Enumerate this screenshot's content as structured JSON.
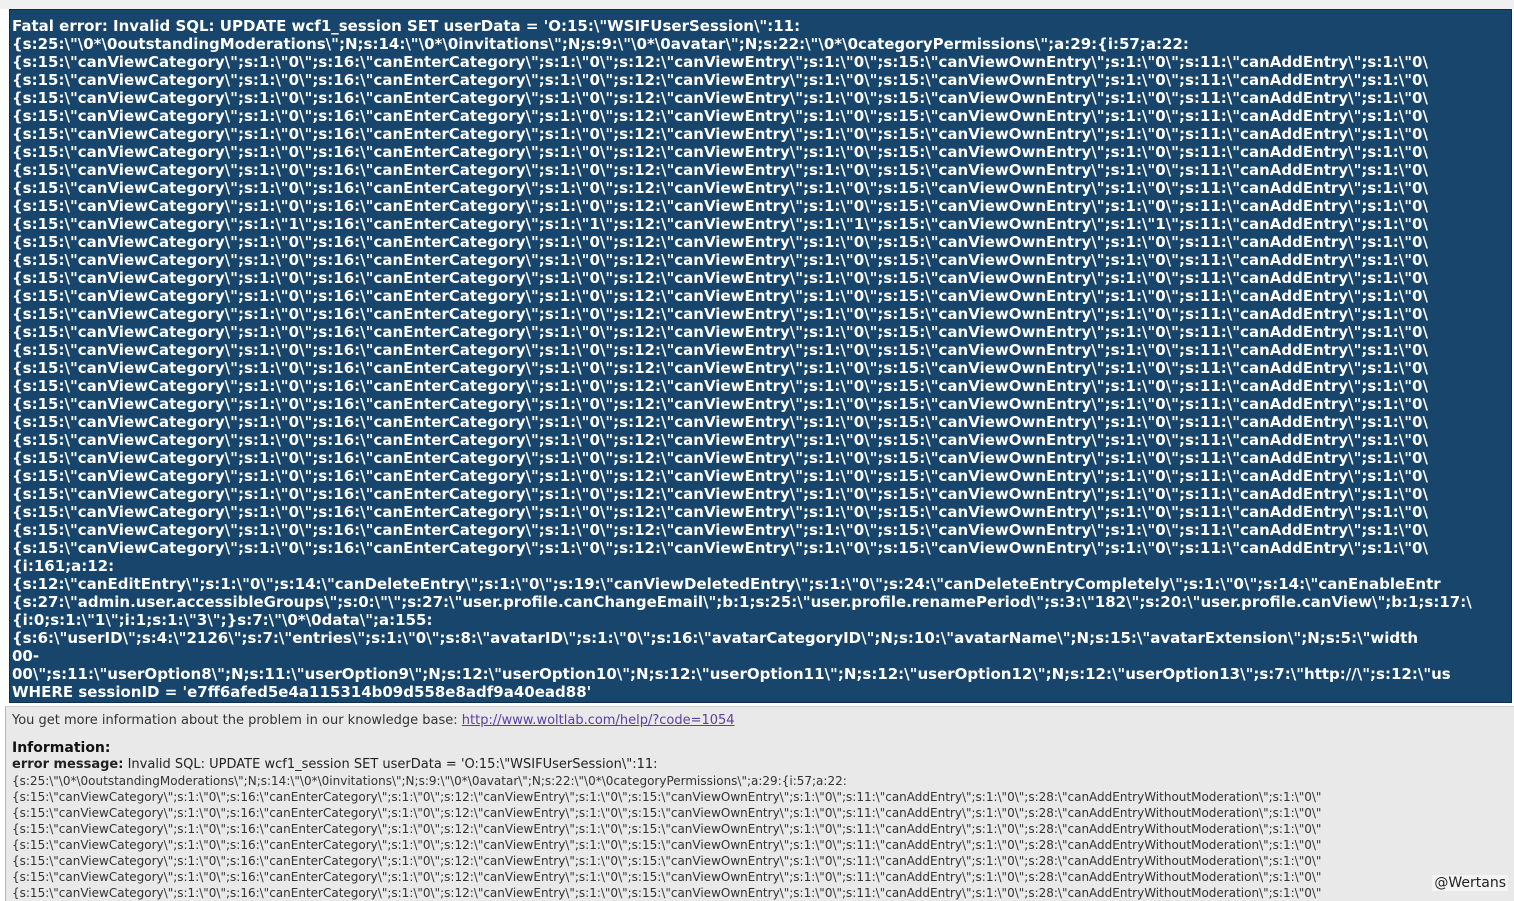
{
  "error": {
    "lines": [
      "Fatal error: Invalid SQL: UPDATE wcf1_session SET userData = 'O:15:\\\"WSIFUserSession\\\":11:",
      "{s:25:\\\"\\0*\\0outstandingModerations\\\";N;s:14:\\\"\\0*\\0invitations\\\";N;s:9:\\\"\\0*\\0avatar\\\";N;s:22:\\\"\\0*\\0categoryPermissions\\\";a:29:{i:57;a:22:",
      "{s:15:\\\"canViewCategory\\\";s:1:\\\"0\\\";s:16:\\\"canEnterCategory\\\";s:1:\\\"0\\\";s:12:\\\"canViewEntry\\\";s:1:\\\"0\\\";s:15:\\\"canViewOwnEntry\\\";s:1:\\\"0\\\";s:11:\\\"canAddEntry\\\";s:1:\\\"0\\",
      "{s:15:\\\"canViewCategory\\\";s:1:\\\"0\\\";s:16:\\\"canEnterCategory\\\";s:1:\\\"0\\\";s:12:\\\"canViewEntry\\\";s:1:\\\"0\\\";s:15:\\\"canViewOwnEntry\\\";s:1:\\\"0\\\";s:11:\\\"canAddEntry\\\";s:1:\\\"0\\",
      "{s:15:\\\"canViewCategory\\\";s:1:\\\"0\\\";s:16:\\\"canEnterCategory\\\";s:1:\\\"0\\\";s:12:\\\"canViewEntry\\\";s:1:\\\"0\\\";s:15:\\\"canViewOwnEntry\\\";s:1:\\\"0\\\";s:11:\\\"canAddEntry\\\";s:1:\\\"0\\",
      "{s:15:\\\"canViewCategory\\\";s:1:\\\"0\\\";s:16:\\\"canEnterCategory\\\";s:1:\\\"0\\\";s:12:\\\"canViewEntry\\\";s:1:\\\"0\\\";s:15:\\\"canViewOwnEntry\\\";s:1:\\\"0\\\";s:11:\\\"canAddEntry\\\";s:1:\\\"0\\",
      "{s:15:\\\"canViewCategory\\\";s:1:\\\"0\\\";s:16:\\\"canEnterCategory\\\";s:1:\\\"0\\\";s:12:\\\"canViewEntry\\\";s:1:\\\"0\\\";s:15:\\\"canViewOwnEntry\\\";s:1:\\\"0\\\";s:11:\\\"canAddEntry\\\";s:1:\\\"0\\",
      "{s:15:\\\"canViewCategory\\\";s:1:\\\"0\\\";s:16:\\\"canEnterCategory\\\";s:1:\\\"0\\\";s:12:\\\"canViewEntry\\\";s:1:\\\"0\\\";s:15:\\\"canViewOwnEntry\\\";s:1:\\\"0\\\";s:11:\\\"canAddEntry\\\";s:1:\\\"0\\",
      "{s:15:\\\"canViewCategory\\\";s:1:\\\"0\\\";s:16:\\\"canEnterCategory\\\";s:1:\\\"0\\\";s:12:\\\"canViewEntry\\\";s:1:\\\"0\\\";s:15:\\\"canViewOwnEntry\\\";s:1:\\\"0\\\";s:11:\\\"canAddEntry\\\";s:1:\\\"0\\",
      "{s:15:\\\"canViewCategory\\\";s:1:\\\"0\\\";s:16:\\\"canEnterCategory\\\";s:1:\\\"0\\\";s:12:\\\"canViewEntry\\\";s:1:\\\"0\\\";s:15:\\\"canViewOwnEntry\\\";s:1:\\\"0\\\";s:11:\\\"canAddEntry\\\";s:1:\\\"0\\",
      "{s:15:\\\"canViewCategory\\\";s:1:\\\"0\\\";s:16:\\\"canEnterCategory\\\";s:1:\\\"0\\\";s:12:\\\"canViewEntry\\\";s:1:\\\"0\\\";s:15:\\\"canViewOwnEntry\\\";s:1:\\\"0\\\";s:11:\\\"canAddEntry\\\";s:1:\\\"0\\",
      "{s:15:\\\"canViewCategory\\\";s:1:\\\"1\\\";s:16:\\\"canEnterCategory\\\";s:1:\\\"1\\\";s:12:\\\"canViewEntry\\\";s:1:\\\"1\\\";s:15:\\\"canViewOwnEntry\\\";s:1:\\\"1\\\";s:11:\\\"canAddEntry\\\";s:1:\\\"0\\",
      "{s:15:\\\"canViewCategory\\\";s:1:\\\"0\\\";s:16:\\\"canEnterCategory\\\";s:1:\\\"0\\\";s:12:\\\"canViewEntry\\\";s:1:\\\"0\\\";s:15:\\\"canViewOwnEntry\\\";s:1:\\\"0\\\";s:11:\\\"canAddEntry\\\";s:1:\\\"0\\",
      "{s:15:\\\"canViewCategory\\\";s:1:\\\"0\\\";s:16:\\\"canEnterCategory\\\";s:1:\\\"0\\\";s:12:\\\"canViewEntry\\\";s:1:\\\"0\\\";s:15:\\\"canViewOwnEntry\\\";s:1:\\\"0\\\";s:11:\\\"canAddEntry\\\";s:1:\\\"0\\",
      "{s:15:\\\"canViewCategory\\\";s:1:\\\"0\\\";s:16:\\\"canEnterCategory\\\";s:1:\\\"0\\\";s:12:\\\"canViewEntry\\\";s:1:\\\"0\\\";s:15:\\\"canViewOwnEntry\\\";s:1:\\\"0\\\";s:11:\\\"canAddEntry\\\";s:1:\\\"0\\",
      "{s:15:\\\"canViewCategory\\\";s:1:\\\"0\\\";s:16:\\\"canEnterCategory\\\";s:1:\\\"0\\\";s:12:\\\"canViewEntry\\\";s:1:\\\"0\\\";s:15:\\\"canViewOwnEntry\\\";s:1:\\\"0\\\";s:11:\\\"canAddEntry\\\";s:1:\\\"0\\",
      "{s:15:\\\"canViewCategory\\\";s:1:\\\"0\\\";s:16:\\\"canEnterCategory\\\";s:1:\\\"0\\\";s:12:\\\"canViewEntry\\\";s:1:\\\"0\\\";s:15:\\\"canViewOwnEntry\\\";s:1:\\\"0\\\";s:11:\\\"canAddEntry\\\";s:1:\\\"0\\",
      "{s:15:\\\"canViewCategory\\\";s:1:\\\"0\\\";s:16:\\\"canEnterCategory\\\";s:1:\\\"0\\\";s:12:\\\"canViewEntry\\\";s:1:\\\"0\\\";s:15:\\\"canViewOwnEntry\\\";s:1:\\\"0\\\";s:11:\\\"canAddEntry\\\";s:1:\\\"0\\",
      "{s:15:\\\"canViewCategory\\\";s:1:\\\"0\\\";s:16:\\\"canEnterCategory\\\";s:1:\\\"0\\\";s:12:\\\"canViewEntry\\\";s:1:\\\"0\\\";s:15:\\\"canViewOwnEntry\\\";s:1:\\\"0\\\";s:11:\\\"canAddEntry\\\";s:1:\\\"0\\",
      "{s:15:\\\"canViewCategory\\\";s:1:\\\"0\\\";s:16:\\\"canEnterCategory\\\";s:1:\\\"0\\\";s:12:\\\"canViewEntry\\\";s:1:\\\"0\\\";s:15:\\\"canViewOwnEntry\\\";s:1:\\\"0\\\";s:11:\\\"canAddEntry\\\";s:1:\\\"0\\",
      "{s:15:\\\"canViewCategory\\\";s:1:\\\"0\\\";s:16:\\\"canEnterCategory\\\";s:1:\\\"0\\\";s:12:\\\"canViewEntry\\\";s:1:\\\"0\\\";s:15:\\\"canViewOwnEntry\\\";s:1:\\\"0\\\";s:11:\\\"canAddEntry\\\";s:1:\\\"0\\",
      "{s:15:\\\"canViewCategory\\\";s:1:\\\"0\\\";s:16:\\\"canEnterCategory\\\";s:1:\\\"0\\\";s:12:\\\"canViewEntry\\\";s:1:\\\"0\\\";s:15:\\\"canViewOwnEntry\\\";s:1:\\\"0\\\";s:11:\\\"canAddEntry\\\";s:1:\\\"0\\",
      "{s:15:\\\"canViewCategory\\\";s:1:\\\"0\\\";s:16:\\\"canEnterCategory\\\";s:1:\\\"0\\\";s:12:\\\"canViewEntry\\\";s:1:\\\"0\\\";s:15:\\\"canViewOwnEntry\\\";s:1:\\\"0\\\";s:11:\\\"canAddEntry\\\";s:1:\\\"0\\",
      "{s:15:\\\"canViewCategory\\\";s:1:\\\"0\\\";s:16:\\\"canEnterCategory\\\";s:1:\\\"0\\\";s:12:\\\"canViewEntry\\\";s:1:\\\"0\\\";s:15:\\\"canViewOwnEntry\\\";s:1:\\\"0\\\";s:11:\\\"canAddEntry\\\";s:1:\\\"0\\",
      "{s:15:\\\"canViewCategory\\\";s:1:\\\"0\\\";s:16:\\\"canEnterCategory\\\";s:1:\\\"0\\\";s:12:\\\"canViewEntry\\\";s:1:\\\"0\\\";s:15:\\\"canViewOwnEntry\\\";s:1:\\\"0\\\";s:11:\\\"canAddEntry\\\";s:1:\\\"0\\",
      "{s:15:\\\"canViewCategory\\\";s:1:\\\"0\\\";s:16:\\\"canEnterCategory\\\";s:1:\\\"0\\\";s:12:\\\"canViewEntry\\\";s:1:\\\"0\\\";s:15:\\\"canViewOwnEntry\\\";s:1:\\\"0\\\";s:11:\\\"canAddEntry\\\";s:1:\\\"0\\",
      "{s:15:\\\"canViewCategory\\\";s:1:\\\"0\\\";s:16:\\\"canEnterCategory\\\";s:1:\\\"0\\\";s:12:\\\"canViewEntry\\\";s:1:\\\"0\\\";s:15:\\\"canViewOwnEntry\\\";s:1:\\\"0\\\";s:11:\\\"canAddEntry\\\";s:1:\\\"0\\",
      "{s:15:\\\"canViewCategory\\\";s:1:\\\"0\\\";s:16:\\\"canEnterCategory\\\";s:1:\\\"0\\\";s:12:\\\"canViewEntry\\\";s:1:\\\"0\\\";s:15:\\\"canViewOwnEntry\\\";s:1:\\\"0\\\";s:11:\\\"canAddEntry\\\";s:1:\\\"0\\",
      "{s:15:\\\"canViewCategory\\\";s:1:\\\"0\\\";s:16:\\\"canEnterCategory\\\";s:1:\\\"0\\\";s:12:\\\"canViewEntry\\\";s:1:\\\"0\\\";s:15:\\\"canViewOwnEntry\\\";s:1:\\\"0\\\";s:11:\\\"canAddEntry\\\";s:1:\\\"0\\",
      "{s:15:\\\"canViewCategory\\\";s:1:\\\"0\\\";s:16:\\\"canEnterCategory\\\";s:1:\\\"0\\\";s:12:\\\"canViewEntry\\\";s:1:\\\"0\\\";s:15:\\\"canViewOwnEntry\\\";s:1:\\\"0\\\";s:11:\\\"canAddEntry\\\";s:1:\\\"0\\",
      "{i:161;a:12:",
      "{s:12:\\\"canEditEntry\\\";s:1:\\\"0\\\";s:14:\\\"canDeleteEntry\\\";s:1:\\\"0\\\";s:19:\\\"canViewDeletedEntry\\\";s:1:\\\"0\\\";s:24:\\\"canDeleteEntryCompletely\\\";s:1:\\\"0\\\";s:14:\\\"canEnableEntr",
      "{s:27:\\\"admin.user.accessibleGroups\\\";s:0:\\\"\\\";s:27:\\\"user.profile.canChangeEmail\\\";b:1;s:25:\\\"user.profile.renamePeriod\\\";s:3:\\\"182\\\";s:20:\\\"user.profile.canView\\\";b:1;s:17:\\",
      "{i:0;s:1:\\\"1\\\";i:1;s:1:\\\"3\\\";}s:7:\\\"\\0*\\0data\\\";a:155:",
      "{s:6:\\\"userID\\\";s:4:\\\"2126\\\";s:7:\\\"entries\\\";s:1:\\\"0\\\";s:8:\\\"avatarID\\\";s:1:\\\"0\\\";s:16:\\\"avatarCategoryID\\\";N;s:10:\\\"avatarName\\\";N;s:15:\\\"avatarExtension\\\";N;s:5:\\\"width",
      "00-",
      "00\\\";s:11:\\\"userOption8\\\";N;s:11:\\\"userOption9\\\";N;s:12:\\\"userOption10\\\";N;s:12:\\\"userOption11\\\";N;s:12:\\\"userOption12\\\";N;s:12:\\\"userOption13\\\";s:7:\\\"http://\\\";s:12:\\\"us",
      "WHERE sessionID = 'e7ff6afed5e4a115314b09d558e8adf9a40ead88'"
    ]
  },
  "info": {
    "kb_text": "You get more information about the problem in our knowledge base: ",
    "kb_link": "http://www.woltlab.com/help/?code=1054",
    "heading": "Information:",
    "msg_label": "error message:",
    "msg_text": " Invalid SQL: UPDATE wcf1_session SET userData = 'O:15:\\\"WSIFUserSession\\\":11:",
    "lines": [
      "{s:25:\\\"\\0*\\0outstandingModerations\\\";N;s:14:\\\"\\0*\\0invitations\\\";N;s:9:\\\"\\0*\\0avatar\\\";N;s:22:\\\"\\0*\\0categoryPermissions\\\";a:29:{i:57;a:22:",
      "{s:15:\\\"canViewCategory\\\";s:1:\\\"0\\\";s:16:\\\"canEnterCategory\\\";s:1:\\\"0\\\";s:12:\\\"canViewEntry\\\";s:1:\\\"0\\\";s:15:\\\"canViewOwnEntry\\\";s:1:\\\"0\\\";s:11:\\\"canAddEntry\\\";s:1:\\\"0\\\";s:28:\\\"canAddEntryWithoutModeration\\\";s:1:\\\"0\\\"",
      "{s:15:\\\"canViewCategory\\\";s:1:\\\"0\\\";s:16:\\\"canEnterCategory\\\";s:1:\\\"0\\\";s:12:\\\"canViewEntry\\\";s:1:\\\"0\\\";s:15:\\\"canViewOwnEntry\\\";s:1:\\\"0\\\";s:11:\\\"canAddEntry\\\";s:1:\\\"0\\\";s:28:\\\"canAddEntryWithoutModeration\\\";s:1:\\\"0\\\"",
      "{s:15:\\\"canViewCategory\\\";s:1:\\\"0\\\";s:16:\\\"canEnterCategory\\\";s:1:\\\"0\\\";s:12:\\\"canViewEntry\\\";s:1:\\\"0\\\";s:15:\\\"canViewOwnEntry\\\";s:1:\\\"0\\\";s:11:\\\"canAddEntry\\\";s:1:\\\"0\\\";s:28:\\\"canAddEntryWithoutModeration\\\";s:1:\\\"0\\\"",
      "{s:15:\\\"canViewCategory\\\";s:1:\\\"0\\\";s:16:\\\"canEnterCategory\\\";s:1:\\\"0\\\";s:12:\\\"canViewEntry\\\";s:1:\\\"0\\\";s:15:\\\"canViewOwnEntry\\\";s:1:\\\"0\\\";s:11:\\\"canAddEntry\\\";s:1:\\\"0\\\";s:28:\\\"canAddEntryWithoutModeration\\\";s:1:\\\"0\\\"",
      "{s:15:\\\"canViewCategory\\\";s:1:\\\"0\\\";s:16:\\\"canEnterCategory\\\";s:1:\\\"0\\\";s:12:\\\"canViewEntry\\\";s:1:\\\"0\\\";s:15:\\\"canViewOwnEntry\\\";s:1:\\\"0\\\";s:11:\\\"canAddEntry\\\";s:1:\\\"0\\\";s:28:\\\"canAddEntryWithoutModeration\\\";s:1:\\\"0\\\"",
      "{s:15:\\\"canViewCategory\\\";s:1:\\\"0\\\";s:16:\\\"canEnterCategory\\\";s:1:\\\"0\\\";s:12:\\\"canViewEntry\\\";s:1:\\\"0\\\";s:15:\\\"canViewOwnEntry\\\";s:1:\\\"0\\\";s:11:\\\"canAddEntry\\\";s:1:\\\"0\\\";s:28:\\\"canAddEntryWithoutModeration\\\";s:1:\\\"0\\\"",
      "{s:15:\\\"canViewCategory\\\";s:1:\\\"0\\\";s:16:\\\"canEnterCategory\\\";s:1:\\\"0\\\";s:12:\\\"canViewEntry\\\";s:1:\\\"0\\\";s:15:\\\"canViewOwnEntry\\\";s:1:\\\"0\\\";s:11:\\\"canAddEntry\\\";s:1:\\\"0\\\";s:28:\\\"canAddEntryWithoutModeration\\\";s:1:\\\"0\\\""
    ]
  },
  "watermark": "@Wertans"
}
